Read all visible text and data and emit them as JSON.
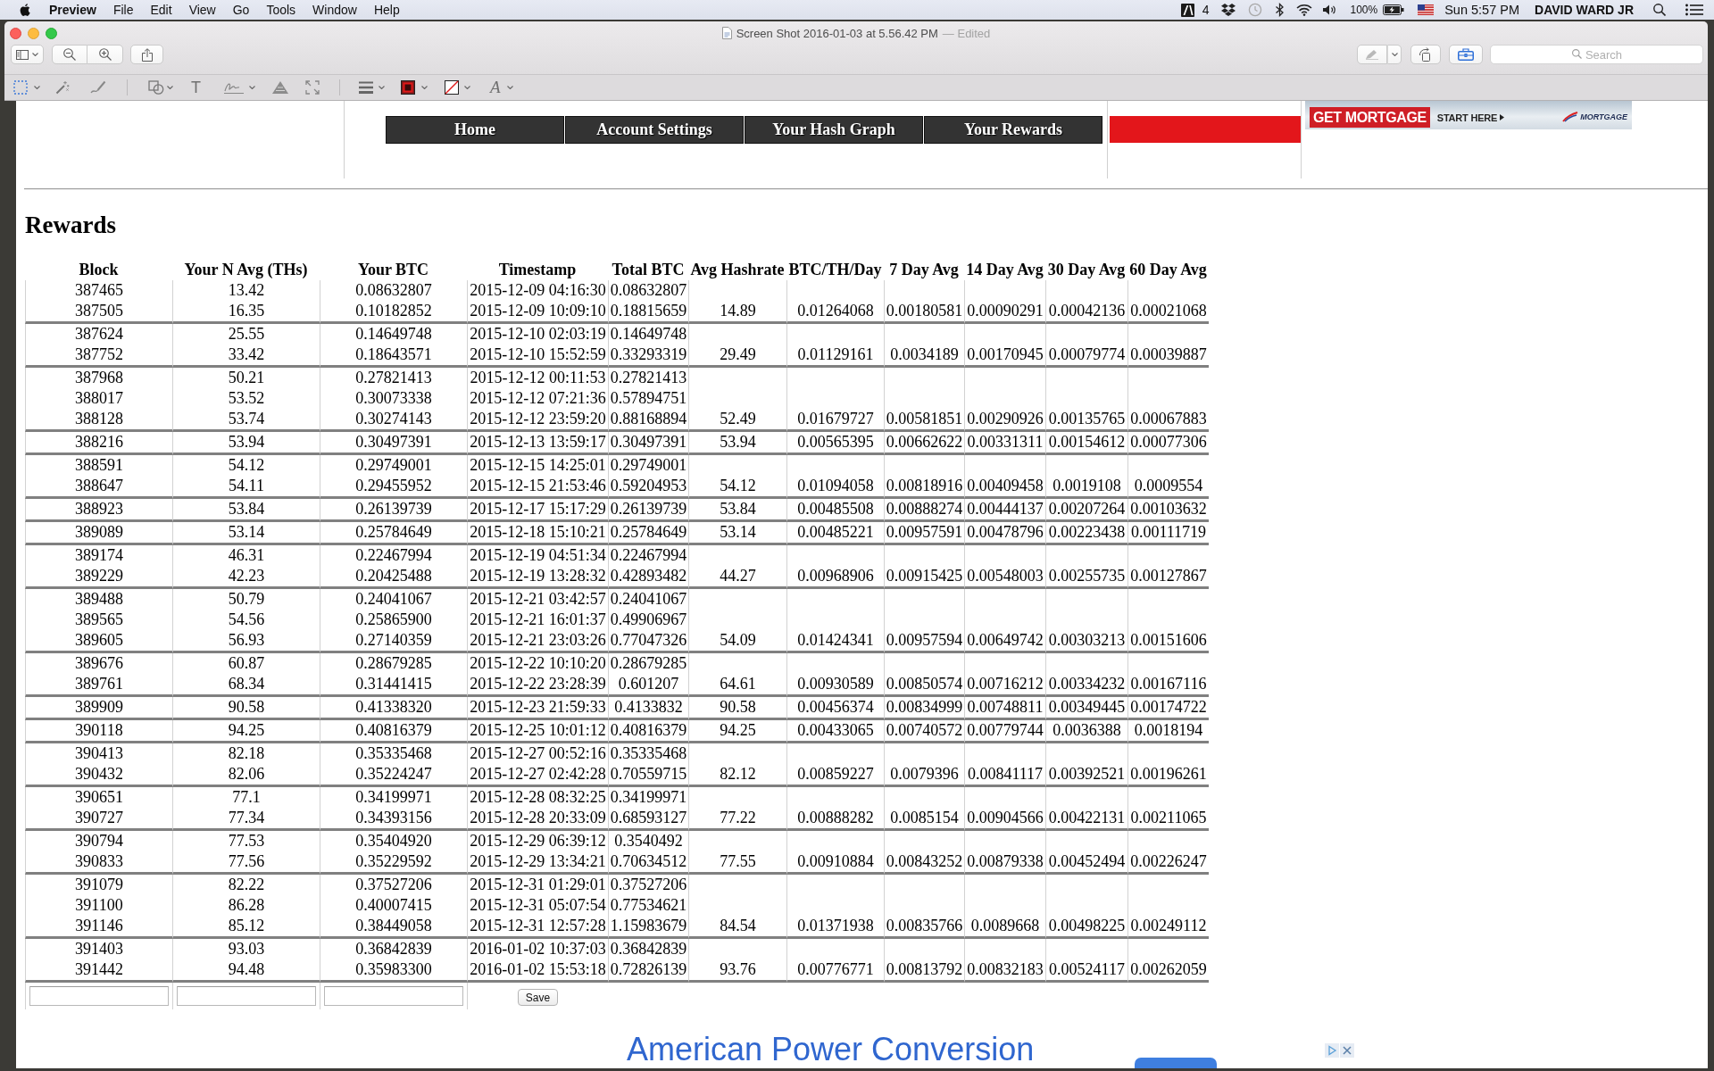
{
  "menu_bar": {
    "app_name": "Preview",
    "menus": [
      "File",
      "Edit",
      "View",
      "Go",
      "Tools",
      "Window",
      "Help"
    ],
    "status_badge": "4",
    "battery": "100%",
    "clock": "Sun 5:57 PM",
    "user": "DAVID WARD JR"
  },
  "window": {
    "title": "Screen Shot 2016-01-03 at 5.56.42 PM",
    "edited_label": "— Edited",
    "search": {
      "placeholder": "Search"
    },
    "markup_bar": {
      "text_tool": "T",
      "font_tool": "A"
    }
  },
  "page": {
    "nav": [
      "Home",
      "Account Settings",
      "Your Hash Graph",
      "Your Rewards"
    ],
    "banner_ad": {
      "headline": "GET MORTGAGE",
      "cta": "START HERE",
      "logo": "MORTGAGE"
    },
    "heading": "Rewards",
    "table": {
      "columns": [
        "Block",
        "Your N Avg (THs)",
        "Your BTC",
        "Timestamp",
        "Total BTC",
        "Avg Hashrate",
        "BTC/TH/Day",
        "7 Day Avg",
        "14 Day Avg",
        "30 Day Avg",
        "60 Day Avg"
      ],
      "groups": [
        {
          "rows": [
            [
              "387465",
              "13.42",
              "0.08632807",
              "2015-12-09 04:16:30",
              "0.08632807"
            ],
            [
              "387505",
              "16.35",
              "0.10182852",
              "2015-12-09 10:09:10",
              "0.18815659"
            ]
          ],
          "summary": [
            "14.89",
            "0.01264068",
            "0.00180581",
            "0.00090291",
            "0.00042136",
            "0.00021068"
          ]
        },
        {
          "rows": [
            [
              "387624",
              "25.55",
              "0.14649748",
              "2015-12-10 02:03:19",
              "0.14649748"
            ],
            [
              "387752",
              "33.42",
              "0.18643571",
              "2015-12-10 15:52:59",
              "0.33293319"
            ]
          ],
          "summary": [
            "29.49",
            "0.01129161",
            "0.0034189",
            "0.00170945",
            "0.00079774",
            "0.00039887"
          ]
        },
        {
          "rows": [
            [
              "387968",
              "50.21",
              "0.27821413",
              "2015-12-12 00:11:53",
              "0.27821413"
            ],
            [
              "388017",
              "53.52",
              "0.30073338",
              "2015-12-12 07:21:36",
              "0.57894751"
            ],
            [
              "388128",
              "53.74",
              "0.30274143",
              "2015-12-12 23:59:20",
              "0.88168894"
            ]
          ],
          "summary": [
            "52.49",
            "0.01679727",
            "0.00581851",
            "0.00290926",
            "0.00135765",
            "0.00067883"
          ]
        },
        {
          "rows": [
            [
              "388216",
              "53.94",
              "0.30497391",
              "2015-12-13 13:59:17",
              "0.30497391"
            ]
          ],
          "summary": [
            "53.94",
            "0.00565395",
            "0.00662622",
            "0.00331311",
            "0.00154612",
            "0.00077306"
          ]
        },
        {
          "rows": [
            [
              "388591",
              "54.12",
              "0.29749001",
              "2015-12-15 14:25:01",
              "0.29749001"
            ],
            [
              "388647",
              "54.11",
              "0.29455952",
              "2015-12-15 21:53:46",
              "0.59204953"
            ]
          ],
          "summary": [
            "54.12",
            "0.01094058",
            "0.00818916",
            "0.00409458",
            "0.0019108",
            "0.0009554"
          ]
        },
        {
          "rows": [
            [
              "388923",
              "53.84",
              "0.26139739",
              "2015-12-17 15:17:29",
              "0.26139739"
            ]
          ],
          "summary": [
            "53.84",
            "0.00485508",
            "0.00888274",
            "0.00444137",
            "0.00207264",
            "0.00103632"
          ]
        },
        {
          "rows": [
            [
              "389089",
              "53.14",
              "0.25784649",
              "2015-12-18 15:10:21",
              "0.25784649"
            ]
          ],
          "summary": [
            "53.14",
            "0.00485221",
            "0.00957591",
            "0.00478796",
            "0.00223438",
            "0.00111719"
          ]
        },
        {
          "rows": [
            [
              "389174",
              "46.31",
              "0.22467994",
              "2015-12-19 04:51:34",
              "0.22467994"
            ],
            [
              "389229",
              "42.23",
              "0.20425488",
              "2015-12-19 13:28:32",
              "0.42893482"
            ]
          ],
          "summary": [
            "44.27",
            "0.00968906",
            "0.00915425",
            "0.00548003",
            "0.00255735",
            "0.00127867"
          ]
        },
        {
          "rows": [
            [
              "389488",
              "50.79",
              "0.24041067",
              "2015-12-21 03:42:57",
              "0.24041067"
            ],
            [
              "389565",
              "54.56",
              "0.25865900",
              "2015-12-21 16:01:37",
              "0.49906967"
            ],
            [
              "389605",
              "56.93",
              "0.27140359",
              "2015-12-21 23:03:26",
              "0.77047326"
            ]
          ],
          "summary": [
            "54.09",
            "0.01424341",
            "0.00957594",
            "0.00649742",
            "0.00303213",
            "0.00151606"
          ]
        },
        {
          "rows": [
            [
              "389676",
              "60.87",
              "0.28679285",
              "2015-12-22 10:10:20",
              "0.28679285"
            ],
            [
              "389761",
              "68.34",
              "0.31441415",
              "2015-12-22 23:28:39",
              "0.601207"
            ]
          ],
          "summary": [
            "64.61",
            "0.00930589",
            "0.00850574",
            "0.00716212",
            "0.00334232",
            "0.00167116"
          ]
        },
        {
          "rows": [
            [
              "389909",
              "90.58",
              "0.41338320",
              "2015-12-23 21:59:33",
              "0.4133832"
            ]
          ],
          "summary": [
            "90.58",
            "0.00456374",
            "0.00834999",
            "0.00748811",
            "0.00349445",
            "0.00174722"
          ]
        },
        {
          "rows": [
            [
              "390118",
              "94.25",
              "0.40816379",
              "2015-12-25 10:01:12",
              "0.40816379"
            ]
          ],
          "summary": [
            "94.25",
            "0.00433065",
            "0.00740572",
            "0.00779744",
            "0.0036388",
            "0.0018194"
          ]
        },
        {
          "rows": [
            [
              "390413",
              "82.18",
              "0.35335468",
              "2015-12-27 00:52:16",
              "0.35335468"
            ],
            [
              "390432",
              "82.06",
              "0.35224247",
              "2015-12-27 02:42:28",
              "0.70559715"
            ]
          ],
          "summary": [
            "82.12",
            "0.00859227",
            "0.0079396",
            "0.00841117",
            "0.00392521",
            "0.00196261"
          ]
        },
        {
          "rows": [
            [
              "390651",
              "77.1",
              "0.34199971",
              "2015-12-28 08:32:25",
              "0.34199971"
            ],
            [
              "390727",
              "77.34",
              "0.34393156",
              "2015-12-28 20:33:09",
              "0.68593127"
            ]
          ],
          "summary": [
            "77.22",
            "0.00888282",
            "0.0085154",
            "0.00904566",
            "0.00422131",
            "0.00211065"
          ]
        },
        {
          "rows": [
            [
              "390794",
              "77.53",
              "0.35404920",
              "2015-12-29 06:39:12",
              "0.3540492"
            ],
            [
              "390833",
              "77.56",
              "0.35229592",
              "2015-12-29 13:34:21",
              "0.70634512"
            ]
          ],
          "summary": [
            "77.55",
            "0.00910884",
            "0.00843252",
            "0.00879338",
            "0.00452494",
            "0.00226247"
          ]
        },
        {
          "rows": [
            [
              "391079",
              "82.22",
              "0.37527206",
              "2015-12-31 01:29:01",
              "0.37527206"
            ],
            [
              "391100",
              "86.28",
              "0.40007415",
              "2015-12-31 05:07:54",
              "0.77534621"
            ],
            [
              "391146",
              "85.12",
              "0.38449058",
              "2015-12-31 12:57:28",
              "1.15983679"
            ]
          ],
          "summary": [
            "84.54",
            "0.01371938",
            "0.00835766",
            "0.0089668",
            "0.00498225",
            "0.00249112"
          ]
        },
        {
          "rows": [
            [
              "391403",
              "93.03",
              "0.36842839",
              "2016-01-02 10:37:03",
              "0.36842839"
            ],
            [
              "391442",
              "94.48",
              "0.35983300",
              "2016-01-02 15:53:18",
              "0.72826139"
            ]
          ],
          "summary": [
            "93.76",
            "0.00776771",
            "0.00813792",
            "0.00832183",
            "0.00524117",
            "0.00262059"
          ]
        }
      ]
    },
    "form": {
      "fields": [
        {
          "kind": "text"
        },
        {
          "kind": "text"
        },
        {
          "kind": "text"
        }
      ],
      "button": "Save"
    },
    "bottom_ad": {
      "headline": "American Power Conversion"
    }
  }
}
